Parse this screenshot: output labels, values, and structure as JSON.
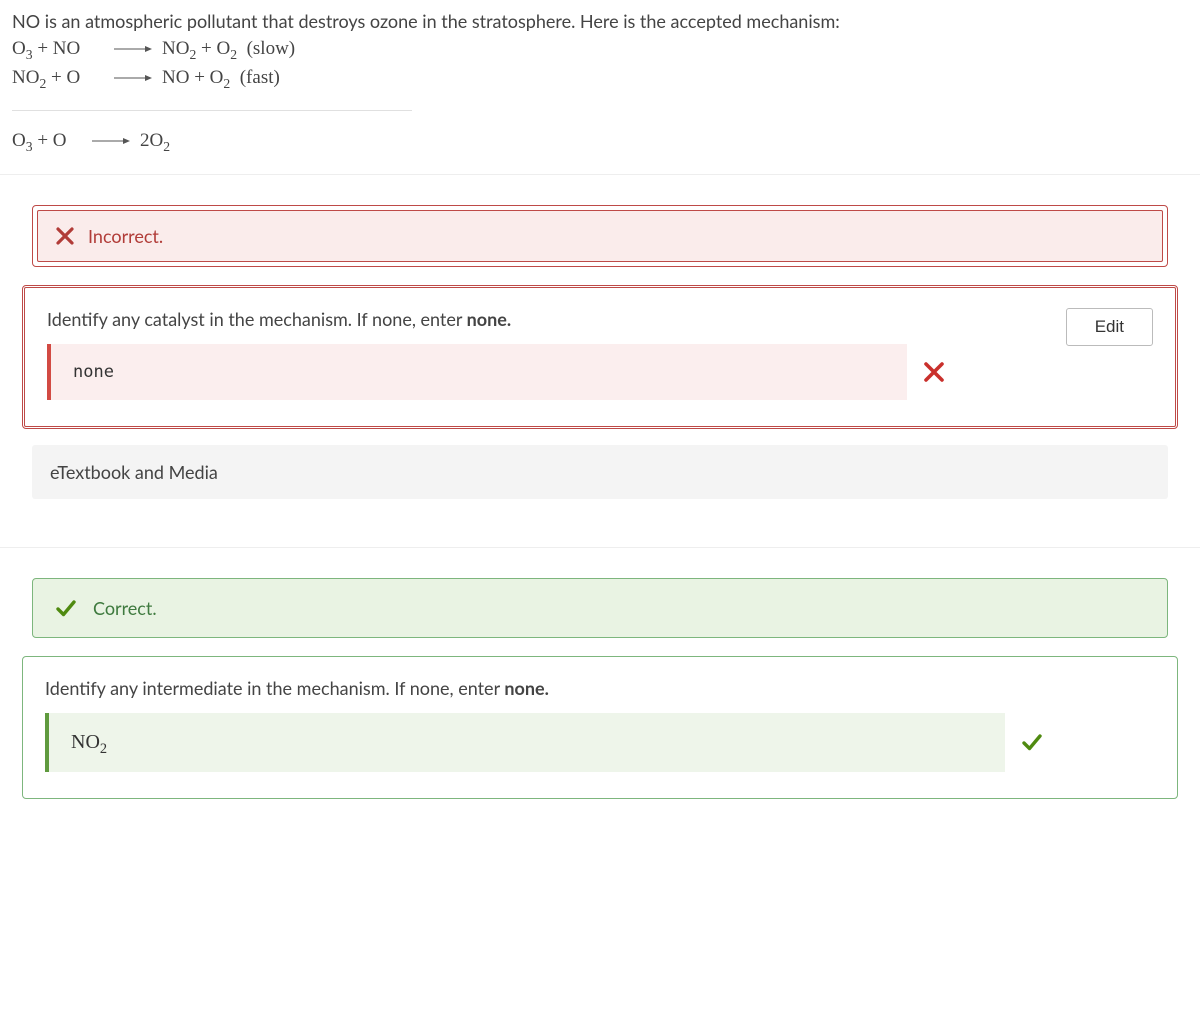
{
  "problem": {
    "intro": "NO is an atmospheric pollutant that destroys ozone in the stratosphere. Here is the accepted mechanism:",
    "step1_note": "(slow)",
    "step2_note": "(fast)"
  },
  "feedback": {
    "incorrect_label": "Incorrect.",
    "correct_label": "Correct."
  },
  "q1": {
    "prompt_prefix": "Identify any catalyst in the mechanism. If none, enter ",
    "prompt_bold": "none.",
    "answer": "none",
    "edit_label": "Edit"
  },
  "etextbook_label": "eTextbook and Media",
  "q2": {
    "prompt_prefix": "Identify any intermediate in the mechanism. If none, enter ",
    "prompt_bold": "none.",
    "answer_base": "NO",
    "answer_sub": "2"
  }
}
